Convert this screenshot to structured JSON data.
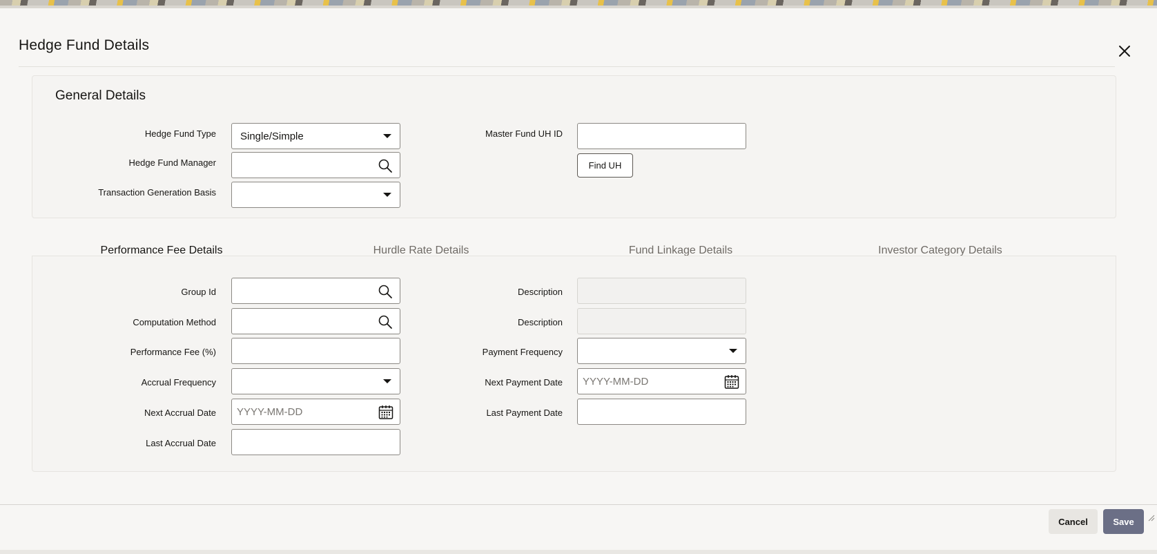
{
  "dialog": {
    "title": "Hedge Fund Details",
    "close_icon": "close-icon"
  },
  "general": {
    "title": "General Details",
    "hedge_fund_type": {
      "label": "Hedge Fund Type",
      "value": "Single/Simple"
    },
    "hedge_fund_manager": {
      "label": "Hedge Fund Manager",
      "value": ""
    },
    "transaction_generation_basis": {
      "label": "Transaction Generation Basis",
      "value": ""
    },
    "master_fund_uh_id": {
      "label": "Master Fund UH ID",
      "value": ""
    },
    "find_uh_label": "Find UH"
  },
  "tabs": [
    {
      "label": "Performance Fee Details",
      "active": true
    },
    {
      "label": "Hurdle Rate Details",
      "active": false
    },
    {
      "label": "Fund Linkage Details",
      "active": false
    },
    {
      "label": "Investor Category Details",
      "active": false
    }
  ],
  "performance": {
    "group_id": {
      "label": "Group Id",
      "value": ""
    },
    "computation_method": {
      "label": "Computation Method",
      "value": ""
    },
    "performance_fee": {
      "label": "Performance Fee (%)",
      "value": ""
    },
    "accrual_frequency": {
      "label": "Accrual Frequency",
      "value": ""
    },
    "next_accrual_date": {
      "label": "Next Accrual Date",
      "placeholder": "YYYY-MM-DD"
    },
    "last_accrual_date": {
      "label": "Last Accrual Date",
      "value": ""
    },
    "description_1": {
      "label": "Description",
      "value": ""
    },
    "description_2": {
      "label": "Description",
      "value": ""
    },
    "payment_frequency": {
      "label": "Payment Frequency",
      "value": ""
    },
    "next_payment_date": {
      "label": "Next Payment Date",
      "placeholder": "YYYY-MM-DD"
    },
    "last_payment_date": {
      "label": "Last Payment Date",
      "value": ""
    }
  },
  "footer": {
    "cancel_label": "Cancel",
    "save_label": "Save"
  },
  "colors": {
    "accent": "#5d6a8a",
    "save_button": "#6b6f86"
  }
}
